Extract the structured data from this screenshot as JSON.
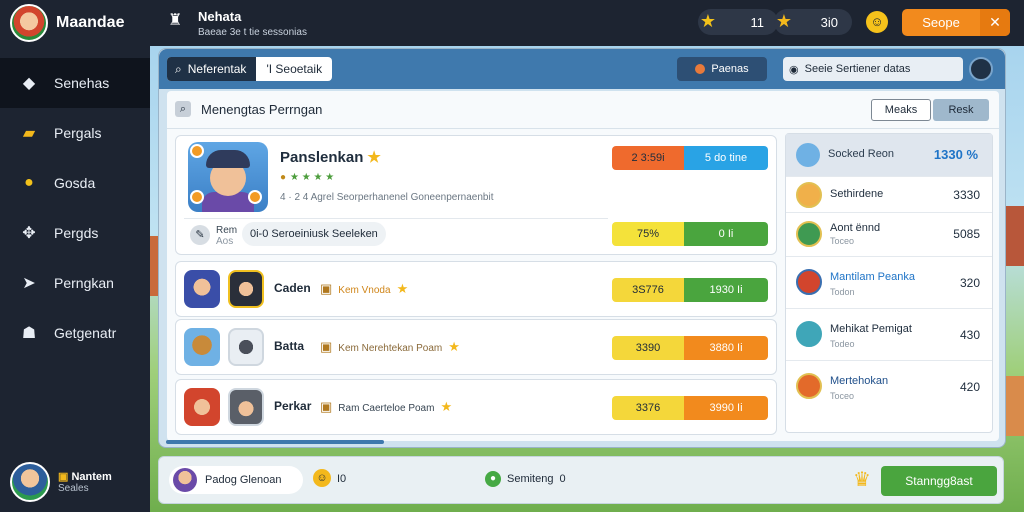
{
  "app": {
    "name": "Maandae"
  },
  "sidebar": {
    "items": [
      {
        "label": "Senehas",
        "icon": "diamond-icon"
      },
      {
        "label": "Pergals",
        "icon": "folder-icon"
      },
      {
        "label": "Gosda",
        "icon": "coin-icon"
      },
      {
        "label": "Pergds",
        "icon": "puzzle-icon"
      },
      {
        "label": "Perngkan",
        "icon": "bird-icon"
      },
      {
        "label": "Getgenatr",
        "icon": "hat-icon"
      }
    ],
    "user": {
      "name": "Nantem",
      "sub": "Seales"
    }
  },
  "topbar": {
    "title": "Nehata",
    "subtitle": "Baeae 3e t tie sessonias",
    "stat_a": "11",
    "stat_b": "3i0",
    "cta_label": "Seope",
    "close_symbol": "✕"
  },
  "panel": {
    "tabs": [
      {
        "label": "Neferentak",
        "active": true
      },
      {
        "label": "'I Seoetaik",
        "active": false
      }
    ],
    "pill_button": "Paenas",
    "search_text": "Seeie Sertiener datas",
    "content_title": "Menengtas Perrngan",
    "btn_mode": "Meaks",
    "btn_reset": "Resk"
  },
  "featured": {
    "name": "Panslenkan",
    "rank": "★ ★ ★ ★",
    "desc": "4 · 2 4 Agrel Seorperhanenel Goneenpernaenbit",
    "bar_left": "2 3:59i",
    "bar_right": "5 do tine",
    "sub_label": "Rem",
    "sub_sublabel": "Aos",
    "sub_chip": "0i-0 Seroeiniusk Seeleken",
    "bar2_left": "75%",
    "bar2_right": "0   Ii"
  },
  "rows": [
    {
      "name": "Caden",
      "tag": "Kem Vnoda",
      "left": "3S776",
      "right": "1930   Ii",
      "color": "#4aa53e"
    },
    {
      "name": "Batta",
      "tag": "Kem Nerehtekan Poam",
      "left": "3390",
      "right": "3880   Ii",
      "color": "#f28a1d"
    },
    {
      "name": "Perkar",
      "tag": "Ram Caerteloe Poam",
      "left": "3376",
      "right": "3990   Ii",
      "color": "#f28a1d"
    }
  ],
  "leaderboard": {
    "title": "Socked Reon",
    "total": "1330 %",
    "entries": [
      {
        "name": "Sethirdene",
        "sub": "",
        "value": "3330"
      },
      {
        "name": "Aont ënnd",
        "sub": "Toceo",
        "value": "5085"
      },
      {
        "name": "Mantilam Peanka",
        "sub": "Todon",
        "value": "320"
      },
      {
        "name": "Mehikat Pemigat",
        "sub": "Todeo",
        "value": "430"
      },
      {
        "name": "Mertehokan",
        "sub": "Toceo",
        "value": "420"
      }
    ]
  },
  "bottombar": {
    "chip": "Padog Glenoan",
    "coin_value": "I0",
    "status": "Semiteng",
    "status_value": "0",
    "cta": "Stanngg8ast"
  },
  "colors": {
    "accent": "#f28a1d",
    "nav_bg": "#1d2431",
    "tab_bar": "#3f79ad",
    "success": "#4aa53e"
  }
}
